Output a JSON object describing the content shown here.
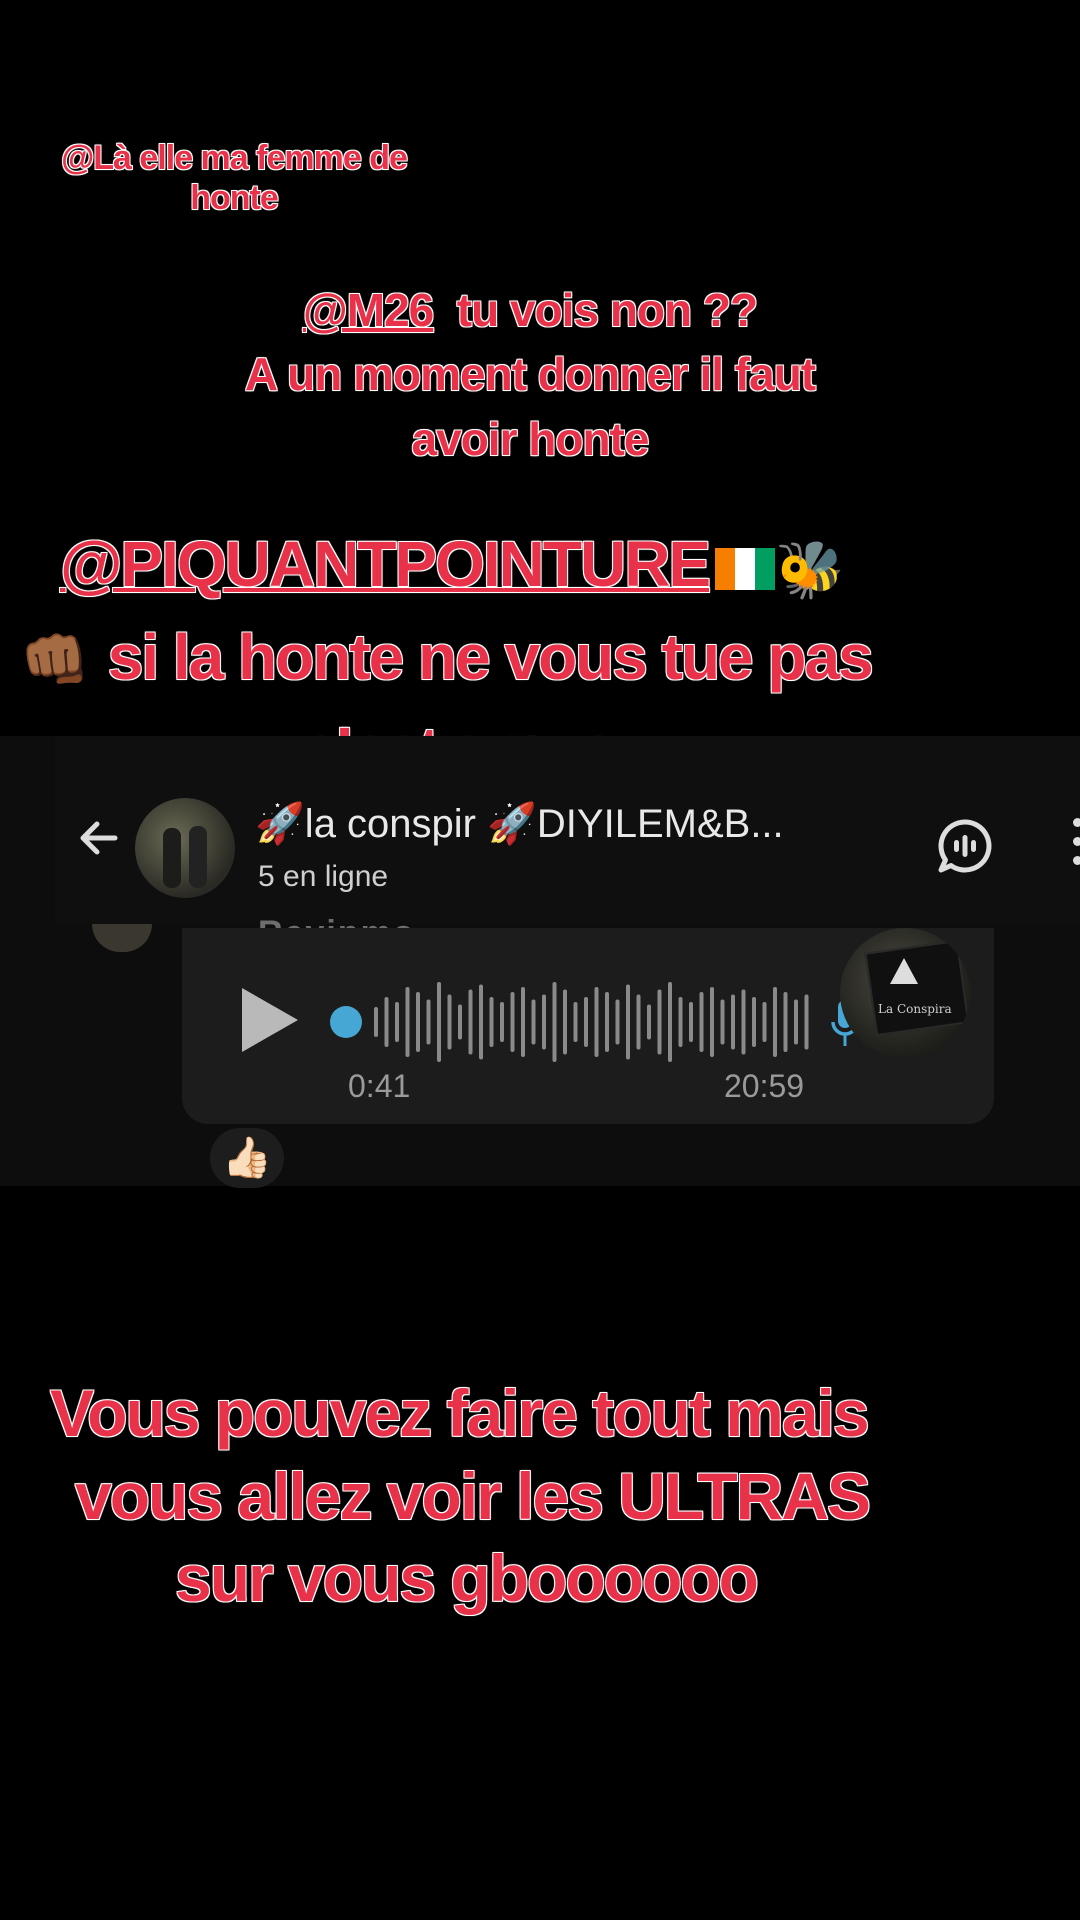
{
  "captions": {
    "c1_line1": "@Là elle ma femme de",
    "c1_line2": "honte",
    "c2_mention": "@M26",
    "c2_rest": "  tu vois non ??",
    "c2_line2": "A un moment donner il faut",
    "c2_line3": "avoir honte",
    "c3_mention": "@PIQUANTPOINTURE",
    "c3_line2": "si la honte ne vous tue pas",
    "c3_line3": "c’est grave",
    "c4_line1": "Vous pouvez faire tout mais",
    "c4_line2": "vous allez voir les ULTRAS",
    "c4_line3": "sur vous gboooooo"
  },
  "emoji": {
    "bee": "🐝",
    "fist": "👊🏾",
    "thumbs": "👍🏻"
  },
  "chat": {
    "group_name": "🚀la conspir 🚀DIYILEM&B...",
    "online_status": "5 en ligne",
    "partial_sender": "Revinmo...",
    "voice_duration": "0:41",
    "message_time": "20:59",
    "sender_avatar_text": "La Conspira"
  },
  "colors": {
    "caption_red": "#e8324a",
    "caption_outline": "#ffffff",
    "progress_dot": "#46a6d4",
    "flag_orange": "#f77f00",
    "flag_white": "#ffffff",
    "flag_green": "#009e60"
  },
  "icons": [
    "back-arrow-icon",
    "voice-chat-icon",
    "more-vertical-icon",
    "play-icon",
    "microphone-icon",
    "ivory-coast-flag-icon"
  ],
  "voice_progress": 0.0
}
